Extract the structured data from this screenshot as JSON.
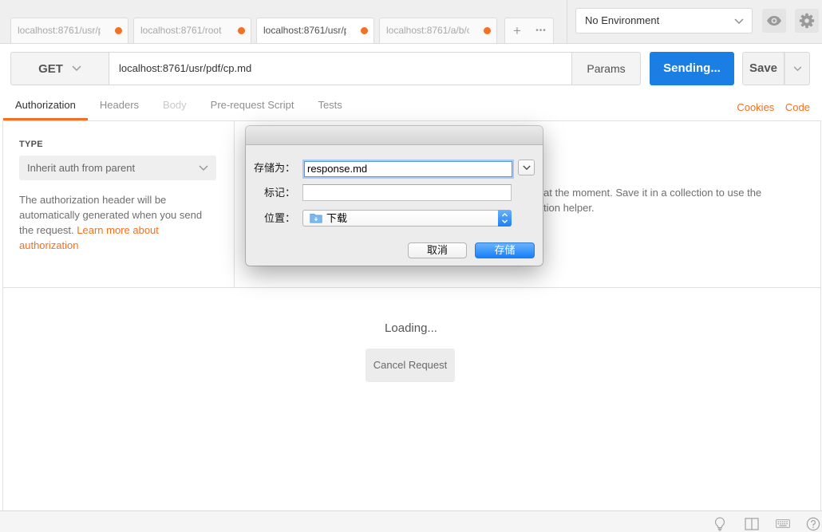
{
  "tabs": [
    {
      "label": "localhost:8761/usr/p",
      "active": false,
      "unsaved": true
    },
    {
      "label": "localhost:8761/root",
      "active": false,
      "unsaved": true
    },
    {
      "label": "localhost:8761/usr/p",
      "active": true,
      "unsaved": true
    },
    {
      "label": "localhost:8761/a/b/c",
      "active": false,
      "unsaved": true
    }
  ],
  "tab_actions": {
    "new_tab": "+",
    "more": "•••"
  },
  "environment": {
    "selected": "No Environment"
  },
  "request": {
    "method": "GET",
    "url": "localhost:8761/usr/pdf/cp.md",
    "params_label": "Params",
    "send_label": "Sending...",
    "save_label": "Save"
  },
  "request_tabs": [
    {
      "label": "Authorization",
      "active": true,
      "disabled": false
    },
    {
      "label": "Headers",
      "active": false,
      "disabled": false
    },
    {
      "label": "Body",
      "active": false,
      "disabled": true
    },
    {
      "label": "Pre-request Script",
      "active": false,
      "disabled": false
    },
    {
      "label": "Tests",
      "active": false,
      "disabled": false
    }
  ],
  "request_links": {
    "cookies": "Cookies",
    "code": "Code"
  },
  "auth": {
    "type_label": "TYPE",
    "type_value": "Inherit auth from parent",
    "description": "The authorization header will be automatically generated when you send the request.",
    "learn_more": "Learn more about authorization",
    "inherit_note_line1": "at the moment. Save it in a collection to use the",
    "inherit_note_line2": "tion helper."
  },
  "response": {
    "loading": "Loading...",
    "cancel_label": "Cancel Request"
  },
  "save_dialog": {
    "save_as_label": "存储为：",
    "save_as_value": "response.md",
    "tags_label": "标记：",
    "tags_value": "",
    "where_label": "位置：",
    "where_value": "下载",
    "cancel_label": "取消",
    "save_label": "存储"
  },
  "icons": {
    "method_dropdown": "chevron-down-icon",
    "environment_dropdown": "chevron-down-icon",
    "environment_quick_look": "eye-icon",
    "settings": "gear-icon",
    "save_dropdown": "chevron-down-icon",
    "auth_type_dropdown": "chevron-down-icon",
    "dialog_expand": "chevron-down-icon",
    "location_folder": "folder-icon",
    "location_stepper": "up-down-arrows-icon",
    "status_bootcamp": "lightbulb-icon",
    "status_layout": "two-pane-layout-icon",
    "status_shortcuts": "keyboard-icon",
    "status_help": "help-icon"
  },
  "colors": {
    "accent_orange": "#f47023",
    "send_blue": "#1b7ee4",
    "dialog_default_blue": "#1680fa"
  }
}
